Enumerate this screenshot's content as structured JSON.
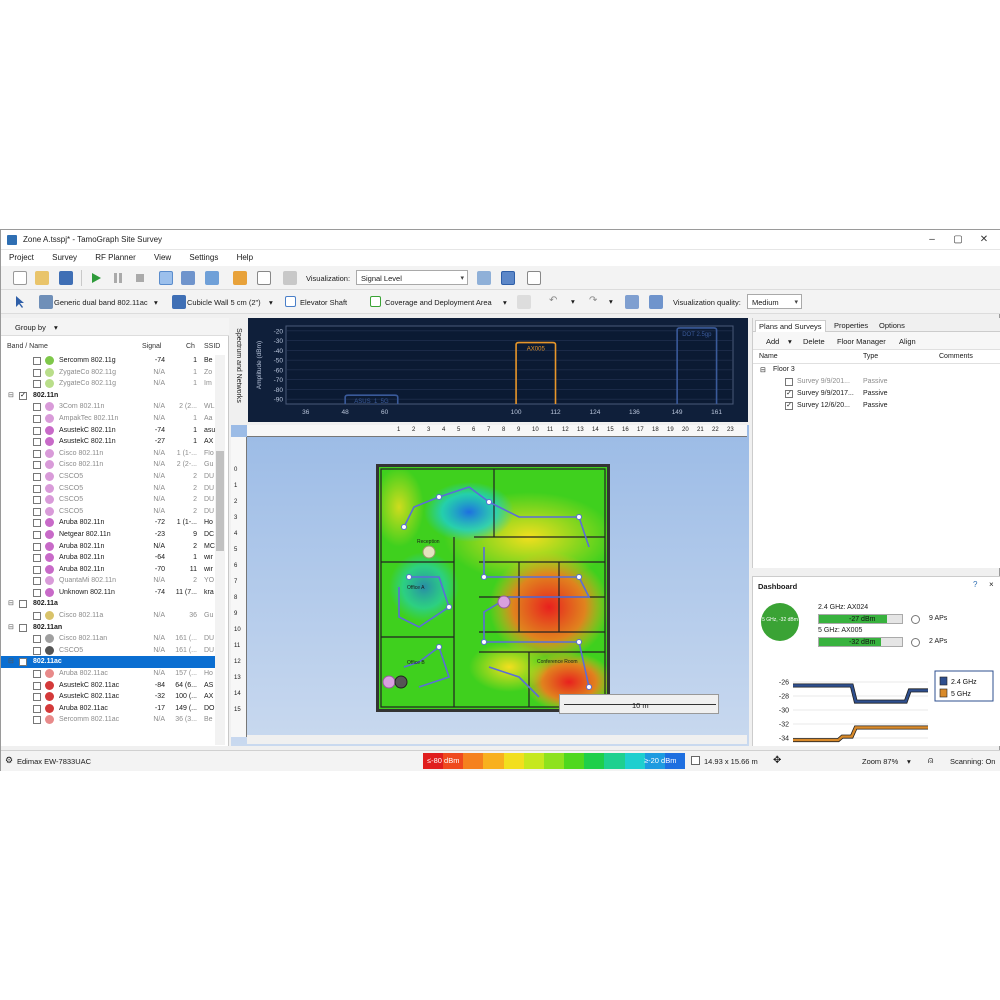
{
  "window": {
    "title": "Zone A.tsspj* - TamoGraph Site Survey"
  },
  "menu": [
    "Project",
    "Survey",
    "RF Planner",
    "View",
    "Settings",
    "Help"
  ],
  "toolbar1": {
    "visualization_label": "Visualization:",
    "visualization_value": "Signal Level"
  },
  "toolbar2": {
    "ap_model": "Generic dual band 802.11ac",
    "wall": "Cubicle Wall 5 cm (2\")",
    "elevator": "Elevator Shaft",
    "coverage": "Coverage and Deployment Area",
    "quality_label": "Visualization quality:",
    "quality_value": "Medium"
  },
  "left_panel": {
    "group_by": "Group by",
    "columns": {
      "name": "Band / Name",
      "signal": "Signal",
      "ch": "Ch",
      "ssid": "SSID"
    },
    "rows": [
      {
        "type": "ap",
        "name": "Sercomm 802.11g",
        "signal": "-74",
        "ch": "1",
        "ssid": "Be",
        "grey": false,
        "color": "#7fc84a"
      },
      {
        "type": "ap",
        "name": "ZygateCo 802.11g",
        "signal": "N/A",
        "ch": "1",
        "ssid": "Zo",
        "grey": true,
        "color": "#b9de8a"
      },
      {
        "type": "ap",
        "name": "ZygateCo 802.11g",
        "signal": "N/A",
        "ch": "1",
        "ssid": "Im",
        "grey": true,
        "color": "#b9de8a"
      },
      {
        "type": "group",
        "name": "802.11n",
        "checked": true
      },
      {
        "type": "ap",
        "name": "3Com 802.11n",
        "signal": "N/A",
        "ch": "2 (2...",
        "ssid": "WL",
        "grey": true,
        "color": "#d99bd9"
      },
      {
        "type": "ap",
        "name": "AmpakTec 802.11n",
        "signal": "N/A",
        "ch": "1",
        "ssid": "Aa",
        "grey": true,
        "color": "#d99bd9"
      },
      {
        "type": "ap",
        "name": "AsustekC 802.11n",
        "signal": "-74",
        "ch": "1",
        "ssid": "asu",
        "grey": false,
        "color": "#c86ac8"
      },
      {
        "type": "ap",
        "name": "AsustekC 802.11n",
        "signal": "-27",
        "ch": "1",
        "ssid": "AX",
        "grey": false,
        "color": "#c86ac8"
      },
      {
        "type": "ap",
        "name": "Cisco 802.11n",
        "signal": "N/A",
        "ch": "1 (1-...",
        "ssid": "Flo",
        "grey": true,
        "color": "#d99bd9"
      },
      {
        "type": "ap",
        "name": "Cisco 802.11n",
        "signal": "N/A",
        "ch": "2 (2-...",
        "ssid": "Gu",
        "grey": true,
        "color": "#d99bd9"
      },
      {
        "type": "ap",
        "name": "CSCO5",
        "signal": "N/A",
        "ch": "2",
        "ssid": "DU",
        "grey": true,
        "color": "#d99bd9"
      },
      {
        "type": "ap",
        "name": "CSCO5",
        "signal": "N/A",
        "ch": "2",
        "ssid": "DU",
        "grey": true,
        "color": "#d99bd9"
      },
      {
        "type": "ap",
        "name": "CSCO5",
        "signal": "N/A",
        "ch": "2",
        "ssid": "DU",
        "grey": true,
        "color": "#d99bd9"
      },
      {
        "type": "ap",
        "name": "CSCO5",
        "signal": "N/A",
        "ch": "2",
        "ssid": "DU",
        "grey": true,
        "color": "#d99bd9"
      },
      {
        "type": "ap",
        "name": "Aruba 802.11n",
        "signal": "-72",
        "ch": "1 (1-...",
        "ssid": "Ho",
        "grey": false,
        "color": "#c86ac8"
      },
      {
        "type": "ap",
        "name": "Netgear 802.11n",
        "signal": "-23",
        "ch": "9",
        "ssid": "DC",
        "grey": false,
        "color": "#c86ac8"
      },
      {
        "type": "ap",
        "name": "Aruba 802.11n",
        "signal": "N/A",
        "ch": "2",
        "ssid": "MC",
        "grey": false,
        "color": "#c86ac8"
      },
      {
        "type": "ap",
        "name": "Aruba 802.11n",
        "signal": "-64",
        "ch": "1",
        "ssid": "wir",
        "grey": false,
        "color": "#c86ac8"
      },
      {
        "type": "ap",
        "name": "Aruba 802.11n",
        "signal": "-70",
        "ch": "11",
        "ssid": "wir",
        "grey": false,
        "color": "#c86ac8"
      },
      {
        "type": "ap",
        "name": "QuantaMi 802.11n",
        "signal": "N/A",
        "ch": "2",
        "ssid": "YO",
        "grey": true,
        "color": "#d99bd9"
      },
      {
        "type": "ap",
        "name": "Unknown 802.11n",
        "signal": "-74",
        "ch": "11 (7...",
        "ssid": "kra",
        "grey": false,
        "color": "#c86ac8"
      },
      {
        "type": "group",
        "name": "802.11a",
        "checked": false
      },
      {
        "type": "ap",
        "name": "Cisco 802.11a",
        "signal": "N/A",
        "ch": "36",
        "ssid": "Gu",
        "grey": true,
        "color": "#d9c36a"
      },
      {
        "type": "group",
        "name": "802.11an",
        "checked": false
      },
      {
        "type": "ap",
        "name": "Cisco 802.11an",
        "signal": "N/A",
        "ch": "161 (...",
        "ssid": "DU",
        "grey": true,
        "color": "#a0a0a0"
      },
      {
        "type": "ap",
        "name": "CSCO5",
        "signal": "N/A",
        "ch": "161 (...",
        "ssid": "DU",
        "grey": true,
        "color": "#555555"
      },
      {
        "type": "group",
        "name": "802.11ac",
        "checked": false,
        "selected": true
      },
      {
        "type": "ap",
        "name": "Aruba 802.11ac",
        "signal": "N/A",
        "ch": "157 (...",
        "ssid": "Ho",
        "grey": true,
        "color": "#e88a8a"
      },
      {
        "type": "ap",
        "name": "AsustekC 802.11ac",
        "signal": "-84",
        "ch": "64 (6...",
        "ssid": "AS",
        "grey": false,
        "color": "#d43a3a"
      },
      {
        "type": "ap",
        "name": "AsustekC 802.11ac",
        "signal": "-32",
        "ch": "100 (...",
        "ssid": "AX",
        "grey": false,
        "color": "#d43a3a"
      },
      {
        "type": "ap",
        "name": "Aruba 802.11ac",
        "signal": "-17",
        "ch": "149 (...",
        "ssid": "DO",
        "grey": false,
        "color": "#d43a3a"
      },
      {
        "type": "ap",
        "name": "Sercomm 802.11ac",
        "signal": "N/A",
        "ch": "36 (3...",
        "ssid": "Be",
        "grey": true,
        "color": "#e88a8a"
      }
    ]
  },
  "spectrum": {
    "side_label": "Spectrum and Networks",
    "y_label": "Amplitude (dBm)",
    "y_ticks": [
      "-20",
      "-30",
      "-40",
      "-50",
      "-60",
      "-70",
      "-80",
      "-90"
    ],
    "x_ticks": [
      "36",
      "48",
      "60",
      "100",
      "112",
      "124",
      "136",
      "149",
      "161"
    ],
    "networks": [
      {
        "label": "ASUS_1_5G",
        "from": 48,
        "to": 64,
        "level": -86,
        "color": "#3a5a9a"
      },
      {
        "label": "AX005",
        "from": 100,
        "to": 112,
        "level": -32,
        "color": "#e8962a"
      },
      {
        "label": "DOT 2.5gp",
        "from": 149,
        "to": 161,
        "level": -17,
        "color": "#3a5a9a"
      }
    ]
  },
  "plan": {
    "h_ruler": [
      "1",
      "2",
      "3",
      "4",
      "5",
      "6",
      "7",
      "8",
      "9",
      "10",
      "11",
      "12",
      "13",
      "14",
      "15",
      "16",
      "17",
      "18",
      "19",
      "20",
      "21",
      "22",
      "23"
    ],
    "v_ruler": [
      "0",
      "1",
      "2",
      "3",
      "4",
      "5",
      "6",
      "7",
      "8",
      "9",
      "10",
      "11",
      "12",
      "13",
      "14",
      "15"
    ],
    "rooms": [
      "Reception",
      "Office A",
      "Office B",
      "Conference Room"
    ],
    "scale": "10 m"
  },
  "right_panel": {
    "tabs": [
      "Plans and Surveys",
      "Properties",
      "Options"
    ],
    "toolbar": [
      "Add",
      "Delete",
      "Floor Manager",
      "Align"
    ],
    "columns": [
      "Name",
      "Type",
      "Comments"
    ],
    "floor": "Floor 3",
    "surveys": [
      {
        "name": "Survey 9/9/201...",
        "type": "Passive",
        "checked": false
      },
      {
        "name": "Survey 9/9/2017...",
        "type": "Passive",
        "checked": true
      },
      {
        "name": "Survey 12/6/20...",
        "type": "Passive",
        "checked": true
      }
    ]
  },
  "dashboard": {
    "title": "Dashboard",
    "circle_text": "5 GHz, -32 dBm",
    "bands": [
      {
        "label": "2.4 GHz: AX024",
        "value": "-27 dBm",
        "fill_pct": 82,
        "aps": "9 APs"
      },
      {
        "label": "5 GHz: AX005",
        "value": "-32 dBm",
        "fill_pct": 75,
        "aps": "2 APs"
      }
    ],
    "chart_data": {
      "type": "line",
      "y_ticks": [
        "-26",
        "-28",
        "-30",
        "-32",
        "-34"
      ],
      "ylim": [
        -35,
        -25
      ],
      "series": [
        {
          "name": "2.4 GHz",
          "color": "#2e4f8f",
          "values": [
            -26.5,
            -26.5,
            -26.5,
            -26.5,
            -26.5,
            -28.8,
            -28.8,
            -28.8,
            -28.8,
            -27.2,
            -27.2
          ]
        },
        {
          "name": "5 GHz",
          "color": "#d98a2a",
          "values": [
            -34.3,
            -34.3,
            -34.3,
            -34.3,
            -33.8,
            -32.5,
            -32.5,
            -32.5,
            -32.5,
            -32.5,
            -32.5
          ]
        }
      ]
    }
  },
  "status": {
    "adapter": "Edimax EW-7833UAC",
    "scale_min": "≤-80 dBm",
    "scale_max": "≥-20 dBm",
    "size": "14.93 x 15.66 m",
    "zoom": "Zoom 87%",
    "scanning": "Scanning: On",
    "scale_colors": [
      "#e01e1e",
      "#ef4a1e",
      "#f5811e",
      "#f8b01e",
      "#f2df1e",
      "#c6e81e",
      "#8ee21e",
      "#4fd81e",
      "#1ecf4a",
      "#1ed08f",
      "#1ecfcf",
      "#1e9be0",
      "#1e6fe0"
    ]
  }
}
